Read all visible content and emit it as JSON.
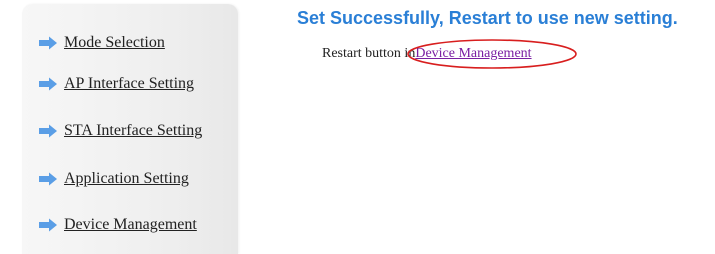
{
  "sidebar": {
    "items": [
      {
        "label": "Mode Selection",
        "icon": "arrow-right-icon"
      },
      {
        "label": "AP Interface Setting",
        "icon": "arrow-right-icon"
      },
      {
        "label": "STA Interface Setting",
        "icon": "arrow-right-icon"
      },
      {
        "label": "Application Setting",
        "icon": "arrow-right-icon"
      },
      {
        "label": "Device Management",
        "icon": "arrow-right-icon"
      }
    ]
  },
  "main": {
    "title": "Set Successfully, Restart to use new setting.",
    "restart_prefix": "Restart button in",
    "restart_link": "Device Management"
  },
  "colors": {
    "title": "#2a7fd6",
    "link": "#7a1fa3",
    "arrow": "#5a9ee6",
    "annotation": "#d81e1e"
  }
}
